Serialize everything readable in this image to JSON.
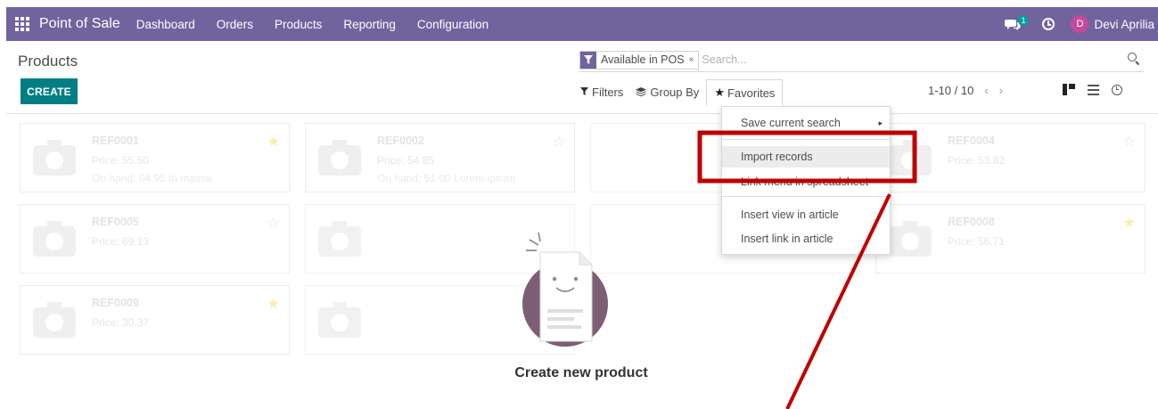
{
  "navbar": {
    "app_name": "Point of Sale",
    "menu": [
      "Dashboard",
      "Orders",
      "Products",
      "Reporting",
      "Configuration"
    ],
    "chat_badge": "1",
    "user_initial": "D",
    "user_name": "Devi Aprilia"
  },
  "control_panel": {
    "breadcrumb": "Products",
    "create_label": "CREATE",
    "search": {
      "facet_label": "Available in POS",
      "facet_remove": "×",
      "placeholder": "Search..."
    },
    "filters_label": "Filters",
    "groupby_label": "Group By",
    "favorites_label": "Favorites",
    "pager": "1-10 / 10",
    "pager_prev": "‹",
    "pager_next": "›"
  },
  "favorites_menu": {
    "items": [
      "Save current search",
      "Import records",
      "Link menu in spreadsheet",
      "Insert view in article",
      "Insert link in article"
    ],
    "submenu_caret": "▸"
  },
  "kanban": {
    "cards": [
      {
        "ref": "REF0001",
        "price": "Price: 55.50",
        "onhand": "On hand: 64.95 In massa",
        "favorite": true
      },
      {
        "ref": "REF0002",
        "price": "Price: 54.85",
        "onhand": "On hand: 51.00 Lorem ipsum",
        "favorite": false
      },
      {
        "ref": "REF0004",
        "price": "Price: 53.82",
        "onhand": "",
        "favorite": false
      },
      {
        "ref": "REF0005",
        "price": "Price: 69.13",
        "onhand": "",
        "favorite": false
      },
      {
        "ref": "REF0008",
        "price": "Price: 56.71",
        "onhand": "",
        "favorite": true
      },
      {
        "ref": "REF0009",
        "price": "Price: 30.37",
        "onhand": "",
        "favorite": true
      }
    ],
    "empty_title": "Create new product"
  },
  "colors": {
    "navbar": "#71639e",
    "primary_button": "#017e84",
    "annotation": "#c00000",
    "favorite_star": "#f3cc00"
  }
}
